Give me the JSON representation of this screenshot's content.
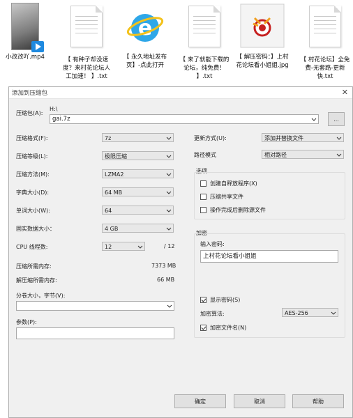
{
  "desktop_files": [
    {
      "name": "小改改吖.mp4",
      "type": "video"
    },
    {
      "name": "【 有种子却没速度？来村花论坛人工加速！ 】.txt",
      "type": "text"
    },
    {
      "name": "【 永久地址发布页】-点此打开",
      "type": "ie"
    },
    {
      "name": "【 来了就能下载的论坛，纯免费！ 】.txt",
      "type": "text"
    },
    {
      "name": "【 解压密码：】上村花论坛看小姐姐.jpg",
      "type": "image"
    },
    {
      "name": "【 村花论坛】全免费-无套路-更新快.txt",
      "type": "text"
    }
  ],
  "dialog": {
    "title": "添加到压缩包",
    "close": "✕",
    "archive": {
      "label": "压缩包(A):",
      "path": "H:\\",
      "value": "gai.7z",
      "browse": "..."
    },
    "left": {
      "format": {
        "label": "压缩格式(F):",
        "value": "7z"
      },
      "level": {
        "label": "压缩等级(L):",
        "value": "极限压缩"
      },
      "method": {
        "label": "压缩方法(M):",
        "value": "LZMA2"
      },
      "dict": {
        "label": "字典大小(D):",
        "value": "64 MB"
      },
      "word": {
        "label": "单词大小(W):",
        "value": "64"
      },
      "solid": {
        "label": "固实数据大小：",
        "value": "4 GB"
      },
      "threads": {
        "label": "CPU 线程数:",
        "value": "12",
        "total": "/ 12"
      },
      "mem_comp": {
        "label": "压缩所需内存:",
        "value": "7373 MB"
      },
      "mem_decomp": {
        "label": "解压缩所需内存:",
        "value": "66 MB"
      },
      "split": {
        "label": "分卷大小，字节(V):",
        "value": ""
      },
      "params": {
        "label": "参数(P):",
        "value": ""
      }
    },
    "right": {
      "update": {
        "label": "更新方式(U):",
        "value": "添加并替换文件"
      },
      "pathmode": {
        "label": "路径模式",
        "value": "相对路径"
      },
      "options": {
        "title": "选项",
        "sfx": {
          "label": "创建自释放程序(X)",
          "checked": false
        },
        "shared": {
          "label": "压缩共享文件",
          "checked": false
        },
        "delete": {
          "label": "操作完成后删除源文件",
          "checked": false
        }
      },
      "encryption": {
        "title": "加密",
        "pw_label": "输入密码:",
        "password": "上村花论坛看小姐姐",
        "show_pw": {
          "label": "显示密码(S)",
          "checked": true
        },
        "method_label": "加密算法:",
        "method": "AES-256",
        "encrypt_names": {
          "label": "加密文件名(N)",
          "checked": true
        }
      }
    },
    "buttons": {
      "ok": "确定",
      "cancel": "取消",
      "help": "帮助"
    }
  }
}
